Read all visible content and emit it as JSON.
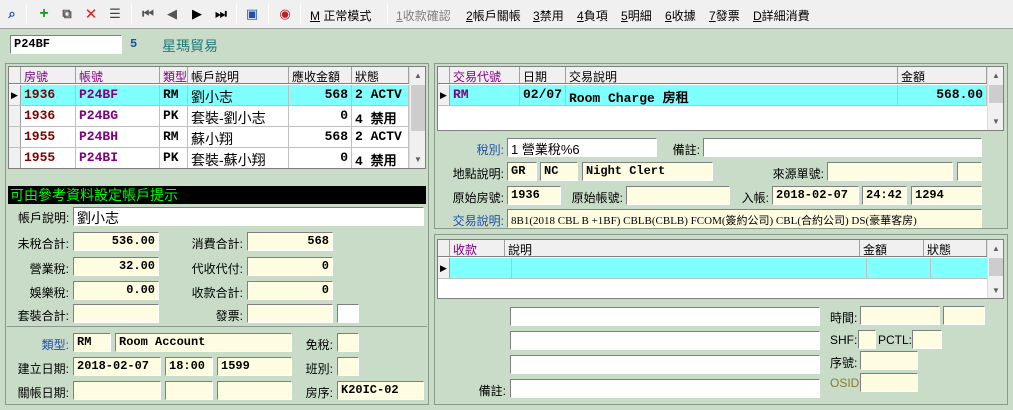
{
  "toolbar": {
    "mode_label": "正常模式",
    "mode_key": "M",
    "menu": [
      {
        "key": "1",
        "label": "收款確認",
        "enabled": false
      },
      {
        "key": "2",
        "label": "帳戶關帳",
        "enabled": true
      },
      {
        "key": "3",
        "label": "禁用",
        "enabled": true
      },
      {
        "key": "4",
        "label": "負項",
        "enabled": true
      },
      {
        "key": "5",
        "label": "明細",
        "enabled": true
      },
      {
        "key": "6",
        "label": "收據",
        "enabled": true
      },
      {
        "key": "7",
        "label": "發票",
        "enabled": true
      },
      {
        "key": "D",
        "label": "詳細消費",
        "enabled": true
      }
    ]
  },
  "header": {
    "account_code": "P24BF",
    "number": "5",
    "company": "星瑪貿易"
  },
  "accounts_grid": {
    "columns": [
      "房號",
      "帳號",
      "類型",
      "帳戶說明",
      "應收金額",
      "狀態"
    ],
    "rows": [
      [
        "1936",
        "P24BF",
        "RM",
        "劉小志",
        "568",
        "2 ACTV"
      ],
      [
        "1936",
        "P24BG",
        "PK",
        "套裝-劉小志",
        "0",
        "4 禁用"
      ],
      [
        "1955",
        "P24BH",
        "RM",
        "蘇小翔",
        "568",
        "2 ACTV"
      ],
      [
        "1955",
        "P24BI",
        "PK",
        "套裝-蘇小翔",
        "0",
        "4 禁用"
      ]
    ]
  },
  "hint_bar": "可由參考資料設定帳戶提示",
  "account_detail": {
    "desc_label": "帳戶說明:",
    "desc_value": "劉小志",
    "pretax_label": "未稅合計:",
    "pretax_value": "536.00",
    "consume_label": "消費合計:",
    "consume_value": "568",
    "tax_label": "營業稅:",
    "tax_value": "32.00",
    "collect_label": "代收代付:",
    "collect_value": "0",
    "ent_label": "娛樂稅:",
    "ent_value": "0.00",
    "receive_label": "收款合計:",
    "receive_value": "0",
    "pkg_label": "套裝合計:",
    "invoice_label": "發票:",
    "type_label": "類型:",
    "type_code": "RM",
    "type_desc": "Room Account",
    "exempt_label": "免稅:",
    "created_label": "建立日期:",
    "created_date": "2018-02-07",
    "created_time": "18:00",
    "created_id": "1599",
    "shift_label": "班別:",
    "close_label": "關帳日期:",
    "room_seq_label": "房序:",
    "room_seq_value": "K20IC-02"
  },
  "trans_grid": {
    "columns": [
      "交易代號",
      "日期",
      "交易說明",
      "金額"
    ],
    "rows": [
      [
        "RM",
        "02/07",
        "Room Charge 房租",
        "568.00"
      ]
    ]
  },
  "trans_detail": {
    "tax_label": "稅別:",
    "tax_value": "1 營業稅%6",
    "note_label": "備註:",
    "loc_label": "地點說明:",
    "loc_a": "GR",
    "loc_b": "NC",
    "loc_c": "Night Clert",
    "src_label": "來源單號:",
    "orig_room_label": "原始房號:",
    "orig_room_value": "1936",
    "orig_acct_label": "原始帳號:",
    "post_label": "入帳:",
    "post_date": "2018-02-07",
    "post_time": "24:42",
    "post_id": "1294",
    "tdesc_label": "交易說明:",
    "tdesc_value": "8B1(2018 CBL B +1BF) CBLB(CBLB) FCOM(簽約公司) CBL(合約公司) DS(豪華客房)"
  },
  "pay_grid": {
    "columns": [
      "收款",
      "說明",
      "金額",
      "狀態"
    ]
  },
  "pay_detail": {
    "note_label": "備註:",
    "time_label": "時間:",
    "shf_label": "SHF:",
    "pctl_label": "PCTL:",
    "seq_label": "序號:",
    "osid_label": "OSID:"
  },
  "colors": {
    "selected": "#80ffff",
    "field": "#fffde1",
    "bg": "#c8dcc8",
    "hint_bg": "#000000",
    "hint_fg": "#00ff00"
  }
}
